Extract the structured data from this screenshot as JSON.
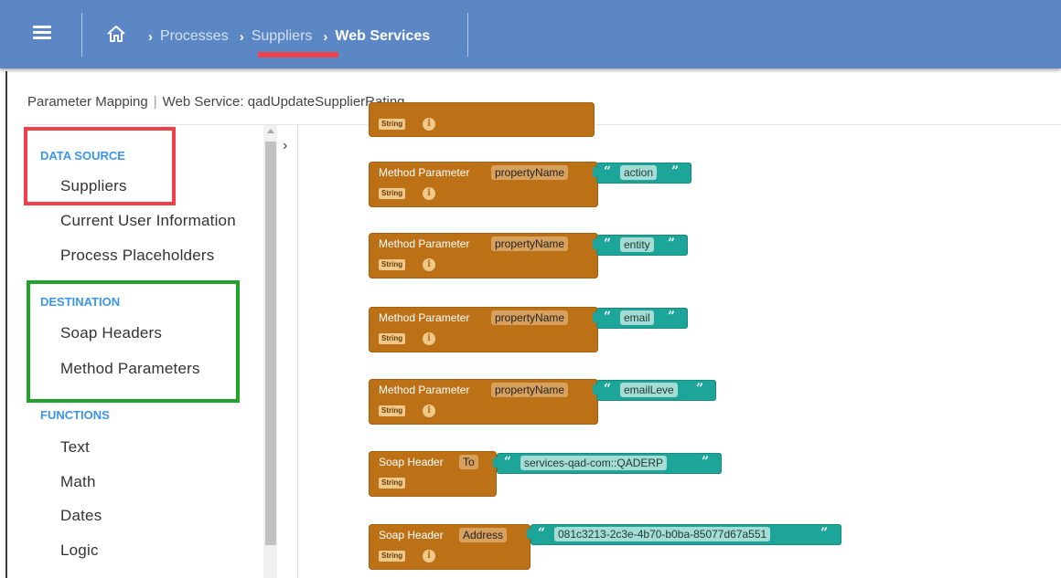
{
  "breadcrumb": {
    "processes": "Processes",
    "suppliers": "Suppliers",
    "current": "Web Services",
    "sep": "›"
  },
  "panel": {
    "title": "Parameter Mapping",
    "subtitle": "Web Service: qadUpdateSupplierRating"
  },
  "sidebar": {
    "data_source": {
      "label": "DATA SOURCE",
      "items": [
        "Suppliers",
        "Current User Information",
        "Process Placeholders"
      ]
    },
    "destination": {
      "label": "DESTINATION",
      "items": [
        "Soap Headers",
        "Method Parameters"
      ]
    },
    "functions": {
      "label": "FUNCTIONS",
      "items": [
        "Text",
        "Math",
        "Dates",
        "Logic"
      ]
    }
  },
  "blocks": [
    {
      "title": "Method Parameter",
      "field": "propertyName",
      "value": "action",
      "type": "String"
    },
    {
      "title": "Method Parameter",
      "field": "propertyName",
      "value": "entity",
      "type": "String"
    },
    {
      "title": "Method Parameter",
      "field": "propertyName",
      "value": "email",
      "type": "String"
    },
    {
      "title": "Method Parameter",
      "field": "propertyName",
      "value": "emailLeve",
      "type": "String"
    },
    {
      "title": "Soap Header",
      "field": "To",
      "value": "services-qad-com::QADERP",
      "type": "String"
    },
    {
      "title": "Soap Header",
      "field": "Address",
      "value": "081c3213-2c3e-4b70-b0ba-85077d67a551",
      "type": "String"
    }
  ],
  "partial_block": {
    "type": "String"
  },
  "glyphs": {
    "quote_open": "“",
    "quote_close": "”",
    "info": "i",
    "chevron": "›"
  },
  "colors": {
    "topbar": "#5b87c5",
    "block": "#bd7116",
    "string_block": "#1ea59a",
    "category": "#3b95e8",
    "highlight_red": "#f0414a",
    "highlight_green": "#1fa32b"
  }
}
